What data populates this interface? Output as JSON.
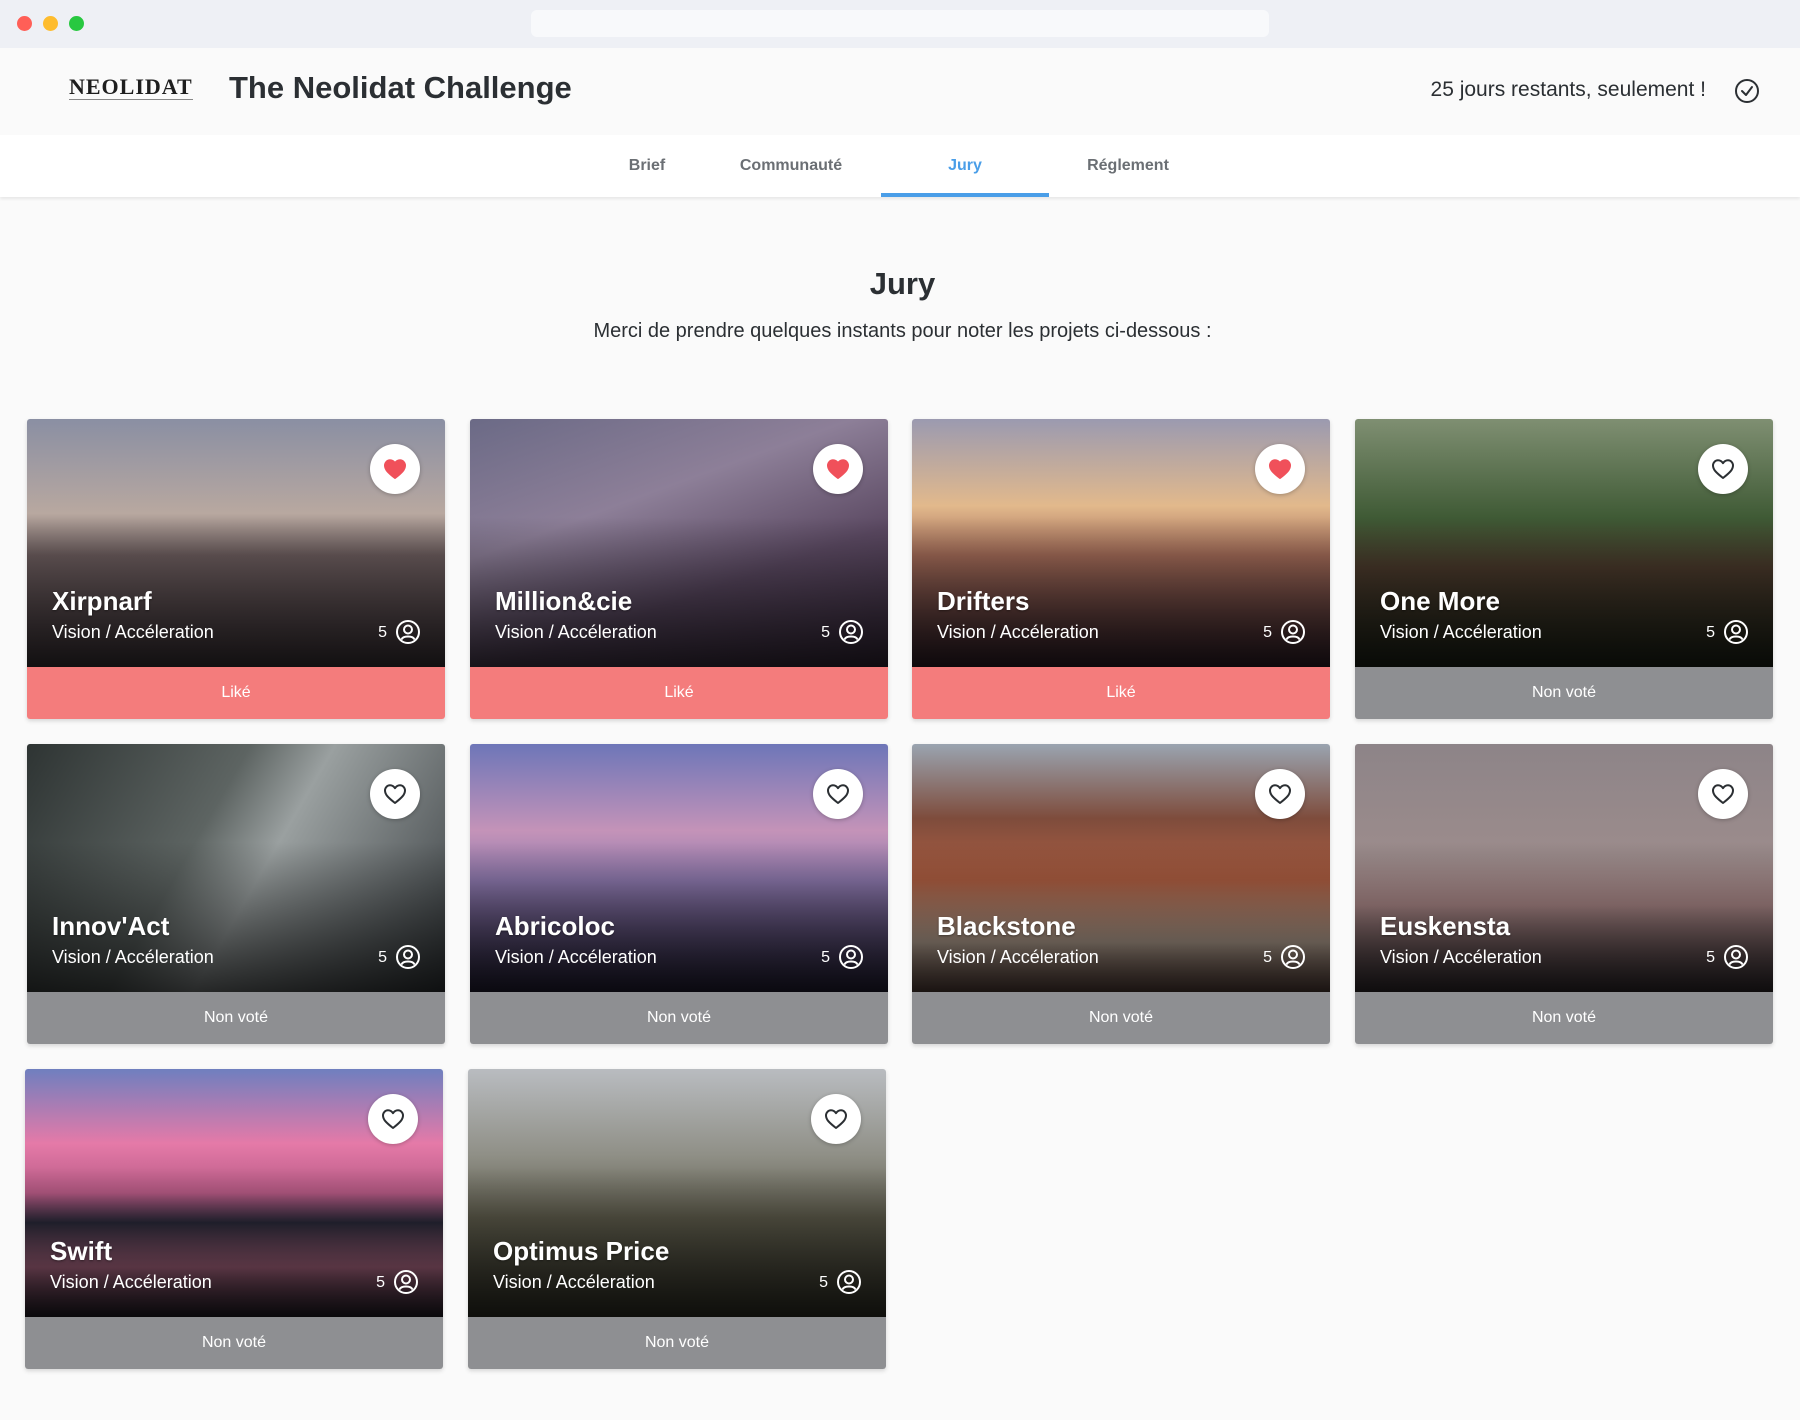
{
  "header": {
    "logo": "NEOLIDAT",
    "title": "The Neolidat Challenge",
    "countdown": "25 jours restants, seulement !"
  },
  "tabs": [
    {
      "label": "Brief",
      "active": false
    },
    {
      "label": "Communauté",
      "active": false
    },
    {
      "label": "Jury",
      "active": true
    },
    {
      "label": "Réglement",
      "active": false
    }
  ],
  "main": {
    "heading": "Jury",
    "subtitle": "Merci de prendre quelques instants pour noter les projets ci-dessous :"
  },
  "colors": {
    "accent": "#4a9ee8",
    "liked": "#f47c7c",
    "not_voted": "#8e8f92",
    "heart": "#f0505a"
  },
  "projects": [
    {
      "name": "Xirpnarf",
      "category": "Vision / Accéleration",
      "count": "5",
      "liked": true,
      "status": "Liké"
    },
    {
      "name": "Million&cie",
      "category": "Vision / Accéleration",
      "count": "5",
      "liked": true,
      "status": "Liké"
    },
    {
      "name": "Drifters",
      "category": "Vision / Accéleration",
      "count": "5",
      "liked": true,
      "status": "Liké"
    },
    {
      "name": "One More",
      "category": "Vision / Accéleration",
      "count": "5",
      "liked": false,
      "status": "Non voté"
    },
    {
      "name": "Innov'Act",
      "category": "Vision / Accéleration",
      "count": "5",
      "liked": false,
      "status": "Non voté"
    },
    {
      "name": "Abricoloc",
      "category": "Vision / Accéleration",
      "count": "5",
      "liked": false,
      "status": "Non voté"
    },
    {
      "name": "Blackstone",
      "category": "Vision / Accéleration",
      "count": "5",
      "liked": false,
      "status": "Non voté"
    },
    {
      "name": "Euskensta",
      "category": "Vision / Accéleration",
      "count": "5",
      "liked": false,
      "status": "Non voté"
    },
    {
      "name": "Swift",
      "category": "Vision / Accéleration",
      "count": "5",
      "liked": false,
      "status": "Non voté"
    },
    {
      "name": "Optimus Price",
      "category": "Vision / Accéleration",
      "count": "5",
      "liked": false,
      "status": "Non voté"
    }
  ]
}
